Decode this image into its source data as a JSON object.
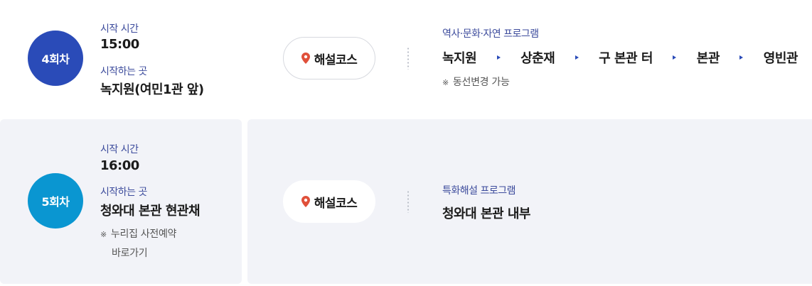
{
  "sessions": [
    {
      "badge": "4회차",
      "start_time_label": "시작 시간",
      "start_time": "15:00",
      "start_place_label": "시작하는 곳",
      "start_place": "녹지원(여민1관 앞)",
      "course_button": "해설코스",
      "program_title": "역사·문화·자연 프로그램",
      "route": [
        "녹지원",
        "상춘재",
        "구 본관 터",
        "본관",
        "영빈관"
      ],
      "route_note": "동선변경 가능",
      "colors": {
        "badge": "#2a4bb8"
      }
    },
    {
      "badge": "5회차",
      "start_time_label": "시작 시간",
      "start_time": "16:00",
      "start_place_label": "시작하는 곳",
      "start_place": "청와대 본관 현관채",
      "place_note_line1": "누리집 사전예약",
      "place_note_line2": "바로가기",
      "course_button": "해설코스",
      "program_title": "특화해설 프로그램",
      "program_detail": "청와대 본관 내부",
      "colors": {
        "badge": "#0a96d1"
      }
    }
  ],
  "icons": {
    "course_button": "map-pin-icon",
    "note": "reference-mark-icon",
    "route_separator": "triangle-right-icon"
  },
  "colors": {
    "label": "#3c4b9c",
    "panel_bg": "#f2f3f8",
    "pin": "#e0503a"
  }
}
